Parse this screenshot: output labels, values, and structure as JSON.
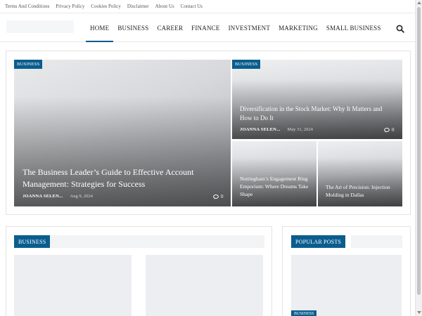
{
  "topbar": {
    "links": [
      "Terms And Conditions",
      "Privacy Policy",
      "Cookies Policy",
      "Disclaimer",
      "About Us",
      "Contact Us"
    ]
  },
  "nav": {
    "items": [
      "HOME",
      "BUSINESS",
      "CAREER",
      "FINANCE",
      "INVESTMENT",
      "MARKETING",
      "SMALL BUSINESS"
    ],
    "active": "HOME"
  },
  "featured": {
    "main": {
      "category": "BUSINESS",
      "title": "The Business Leader’s Guide to Effective Account Management: Strategies for Success",
      "author": "JOANNA SELEN...",
      "date": "Aug 9, 2024",
      "comments": "0"
    },
    "top_right": {
      "category": "BUSINESS",
      "title": "Diversification in the Stock Market: Why It Matters and How to Do It",
      "author": "JOANNA SELEN...",
      "date": "May 31, 2024",
      "comments": "0"
    },
    "bottom_left": {
      "title": "Nottingham’s Engagement Ring Emporium: Where Dreams Take Shape"
    },
    "bottom_right": {
      "title": "The Art of Precision: Injection Molding in Dallas"
    }
  },
  "sections": {
    "business": {
      "label": "BUSINESS"
    },
    "popular": {
      "label": "POPULAR POSTS",
      "card_badge": "BUSINESS"
    }
  },
  "colors": {
    "accent": "#0a5d8e"
  }
}
